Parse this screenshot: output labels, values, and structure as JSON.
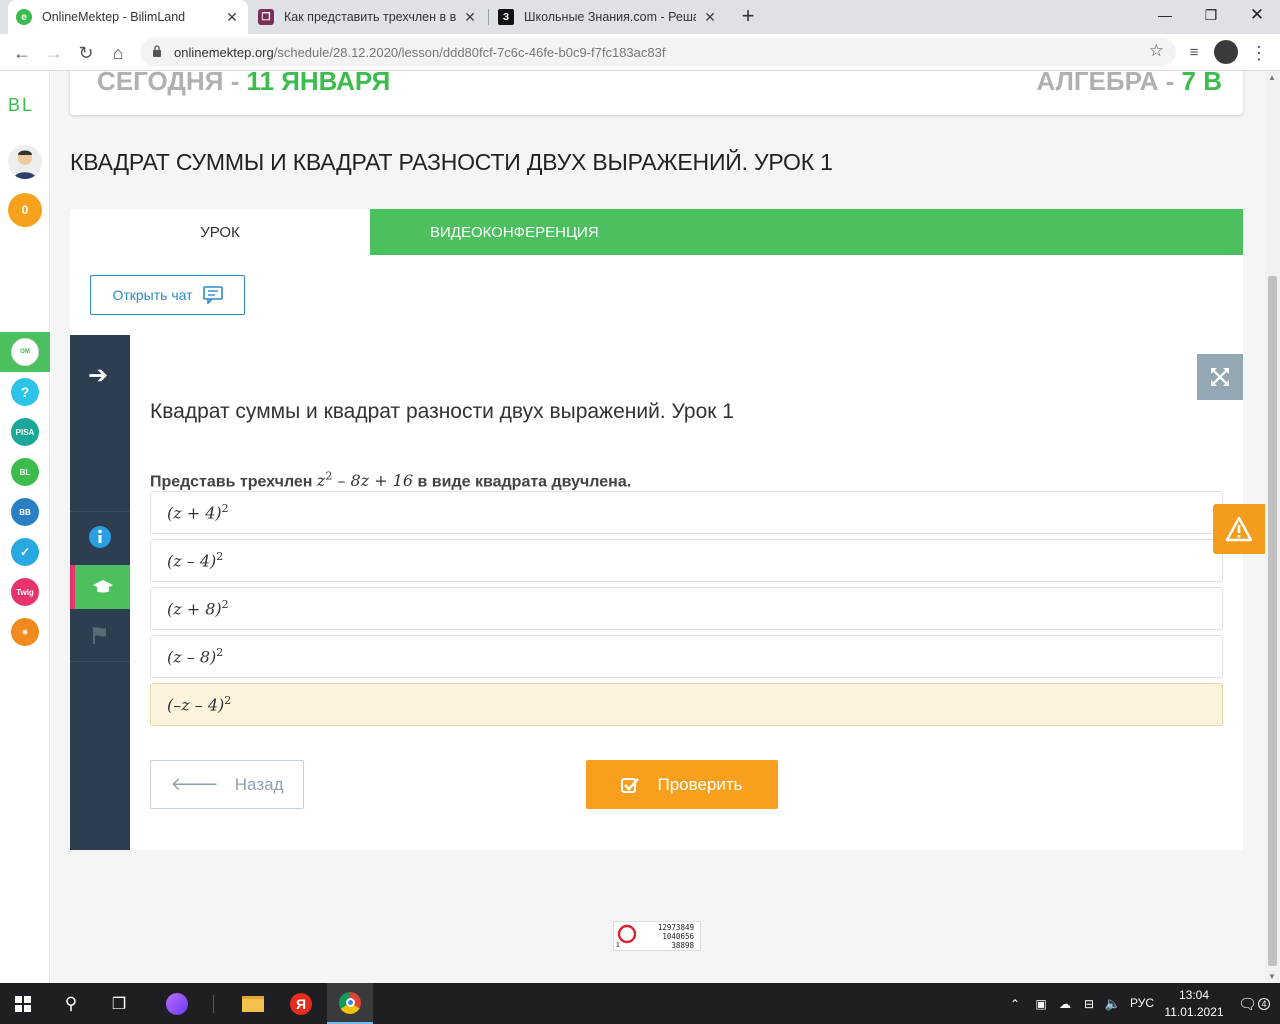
{
  "browser": {
    "tabs": [
      {
        "title": "OnlineMektep - BilimLand",
        "active": true
      },
      {
        "title": "Как представить трехчлен в вид",
        "active": false
      },
      {
        "title": "Школьные Знания.com - Решае",
        "active": false
      }
    ],
    "new_tab": "+",
    "url_host": "onlinemektep.org",
    "url_path": "/schedule/28.12.2020/lesson/ddd80fcf-7c6c-46fe-b0c9-f7fc183ac83f"
  },
  "sidebar": {
    "logo": "BL",
    "badge_count": "0"
  },
  "header": {
    "date_prefix": "СЕГОДНЯ - ",
    "date_value": "11 ЯНВАРЯ",
    "subject_prefix": "АЛГЕБРА - ",
    "subject_value": "7 В"
  },
  "lesson": {
    "title": "КВАДРАТ СУММЫ И КВАДРАТ РАЗНОСТИ ДВУХ ВЫРАЖЕНИЙ. УРОК 1",
    "tabs": [
      "УРОК",
      "ВИДЕОКОНФЕРЕНЦИЯ"
    ],
    "chat_button": "Открыть чат"
  },
  "quiz": {
    "heading": "Квадрат суммы и квадрат разности двух выражений. Урок 1",
    "prompt_before": "Представь трехчлен ",
    "prompt_after": " в виде квадрата двучлена.",
    "expression": {
      "base": "z",
      "exp": "2",
      "rest": " – 8z + 16"
    },
    "options": [
      {
        "expr": "(z + 4)",
        "exp": "2",
        "selected": false
      },
      {
        "expr": "(z – 4)",
        "exp": "2",
        "selected": false
      },
      {
        "expr": "(z + 8)",
        "exp": "2",
        "selected": false
      },
      {
        "expr": "(z – 8)",
        "exp": "2",
        "selected": false
      },
      {
        "expr": "(–z – 4)",
        "exp": "2",
        "selected": true
      }
    ],
    "back_button": "Назад",
    "check_button": "Проверить"
  },
  "counter": {
    "line1": "12973849",
    "line2": "1040656",
    "line3": "38898",
    "small": "1"
  },
  "taskbar": {
    "lang": "РУС",
    "time": "13:04",
    "date": "11.01.2021",
    "notifications": "4"
  },
  "colors": {
    "green": "#4cbf5f",
    "orange": "#f8a01e",
    "navy": "#2c3e4f",
    "blue": "#2d8bc4"
  }
}
